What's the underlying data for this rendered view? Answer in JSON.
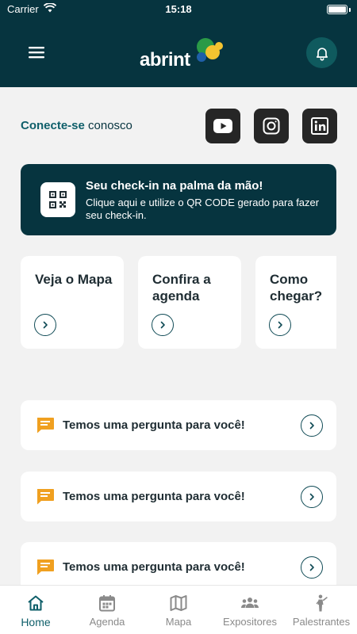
{
  "status_bar": {
    "carrier": "Carrier",
    "time": "15:18"
  },
  "header": {
    "logo_text": "abrint",
    "menu_icon": "hamburger-menu-icon",
    "bell_icon": "bell-icon"
  },
  "connect": {
    "label_bold": "Conecte-se",
    "label_rest": " conosco",
    "social": [
      {
        "name": "youtube-icon"
      },
      {
        "name": "instagram-icon"
      },
      {
        "name": "linkedin-icon"
      }
    ]
  },
  "checkin": {
    "title": "Seu check-in na palma da mão!",
    "description": "Clique aqui e utilize o QR CODE gerado para fazer seu check-in.",
    "icon": "qr-code-icon"
  },
  "quick_cards": [
    {
      "label": "Veja o Mapa"
    },
    {
      "label": "Confira a agenda"
    },
    {
      "label": "Como chegar?"
    }
  ],
  "questions": [
    {
      "text": "Temos uma pergunta para você!"
    },
    {
      "text": "Temos uma pergunta para você!"
    },
    {
      "text": "Temos uma pergunta para você!"
    }
  ],
  "tabs": [
    {
      "label": "Home",
      "icon": "home-icon",
      "active": true
    },
    {
      "label": "Agenda",
      "icon": "calendar-icon",
      "active": false
    },
    {
      "label": "Mapa",
      "icon": "map-icon",
      "active": false
    },
    {
      "label": "Expositores",
      "icon": "group-icon",
      "active": false
    },
    {
      "label": "Palestrantes",
      "icon": "speaker-icon",
      "active": false
    }
  ],
  "colors": {
    "primary": "#06343f",
    "accent": "#0f5f6a",
    "question_icon": "#f0a020",
    "background": "#f2f2f2"
  }
}
